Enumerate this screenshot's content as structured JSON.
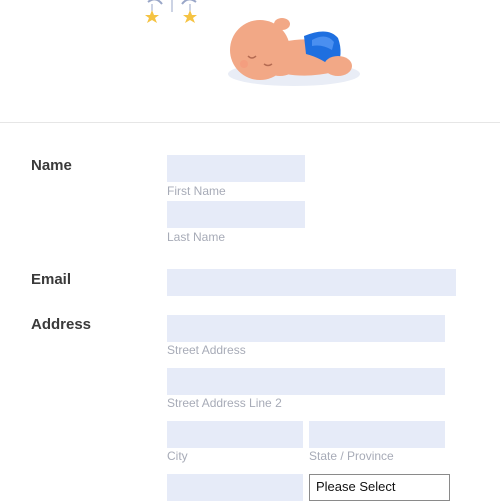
{
  "form": {
    "name": {
      "label": "Name",
      "first_sublabel": "First Name",
      "last_sublabel": "Last Name",
      "first_value": "",
      "last_value": ""
    },
    "email": {
      "label": "Email",
      "value": ""
    },
    "address": {
      "label": "Address",
      "street_sublabel": "Street Address",
      "street2_sublabel": "Street Address Line 2",
      "city_sublabel": "City",
      "state_sublabel": "State / Province",
      "state_select": "Please Select"
    }
  },
  "colors": {
    "input_bg": "#e6ebf8",
    "label": "#3a3a3a",
    "sublabel": "#a7abb7",
    "accent_blue": "#1e6fe0"
  },
  "icons": {
    "header_mobile": "crib-mobile-icon",
    "header_baby": "sleeping-baby-icon"
  }
}
